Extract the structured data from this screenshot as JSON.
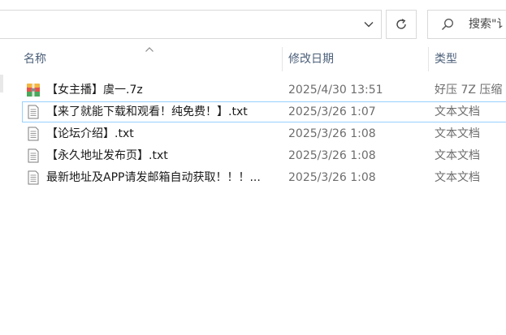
{
  "toolbar": {
    "search_placeholder": "搜索\"讠"
  },
  "columns": {
    "name": "名称",
    "date": "修改日期",
    "type": "类型"
  },
  "files": [
    {
      "name": "【女主播】虞一.7z",
      "date": "2025/4/30 13:51",
      "type": "好压 7Z 压缩",
      "icon": "archive-icon",
      "selected": false
    },
    {
      "name": "【来了就能下载和观看！纯免费！】.txt",
      "date": "2025/3/26 1:07",
      "type": "文本文档",
      "icon": "text-file-icon",
      "selected": true
    },
    {
      "name": "【论坛介绍】.txt",
      "date": "2025/3/26 1:08",
      "type": "文本文档",
      "icon": "text-file-icon",
      "selected": false
    },
    {
      "name": "【永久地址发布页】.txt",
      "date": "2025/3/26 1:08",
      "type": "文本文档",
      "icon": "text-file-icon",
      "selected": false
    },
    {
      "name": "最新地址及APP请发邮箱自动获取！！！...",
      "date": "2025/3/26 1:08",
      "type": "文本文档",
      "icon": "text-file-icon",
      "selected": false
    }
  ],
  "colors": {
    "selection_border": "#99d1ff",
    "header_text": "#4c607a",
    "secondary_text": "#6d6d6d"
  }
}
